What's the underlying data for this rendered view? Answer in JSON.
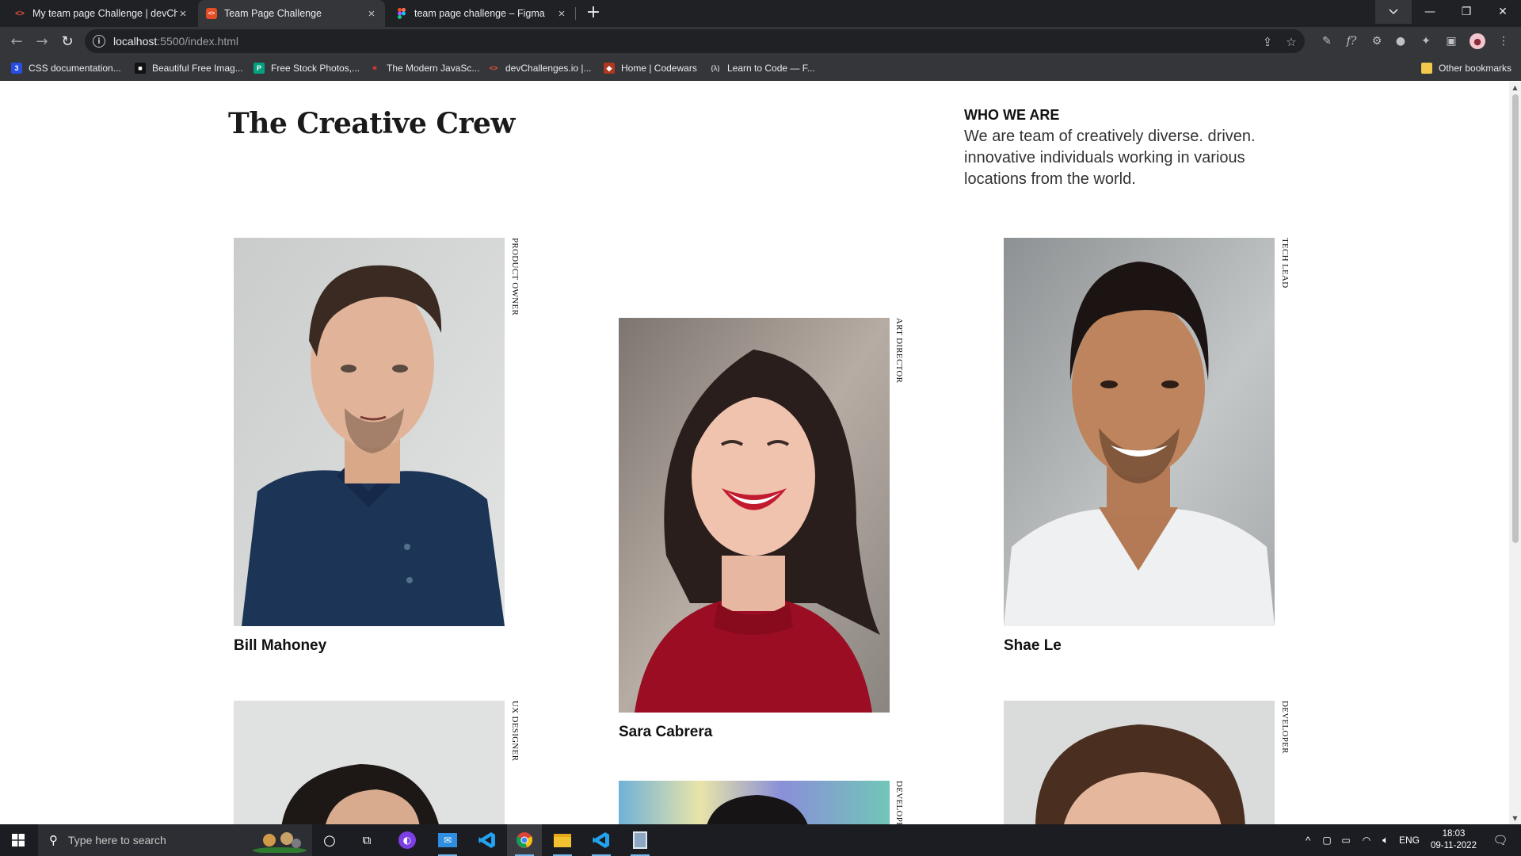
{
  "browser": {
    "tabs": [
      {
        "title": "My team page Challenge | devCh",
        "favicon": "devchallenges-icon",
        "active": false
      },
      {
        "title": "Team Page Challenge",
        "favicon": "html-file-icon",
        "active": true
      },
      {
        "title": "team page challenge – Figma",
        "favicon": "figma-icon",
        "active": false
      }
    ],
    "new_tab": "+",
    "url_host": "localhost",
    "url_path": ":5500/index.html",
    "bookmarks": [
      {
        "label": "CSS documentation...",
        "icon": "css-icon"
      },
      {
        "label": "Beautiful Free Imag...",
        "icon": "unsplash-icon"
      },
      {
        "label": "Free Stock Photos,...",
        "icon": "pexels-icon"
      },
      {
        "label": "The Modern JavaSc...",
        "icon": "javascript-info-icon"
      },
      {
        "label": "devChallenges.io |...",
        "icon": "devchallenges-icon"
      },
      {
        "label": "Home | Codewars",
        "icon": "codewars-icon"
      },
      {
        "label": "Learn to Code — F...",
        "icon": "freecodecamp-icon"
      }
    ],
    "other_bookmarks": "Other bookmarks"
  },
  "page": {
    "heading": "The Creative Crew",
    "who_title": "WHO WE ARE",
    "who_text": "We are team of creatively diverse. driven. innovative individuals working in various locations from the world.",
    "team": [
      {
        "name": "Bill Mahoney",
        "role": "PRODUCT OWNER"
      },
      {
        "name": "Sara Cabrera",
        "role": "ART DIRECTOR"
      },
      {
        "name": "Shae Le",
        "role": "TECH LEAD"
      },
      {
        "name": "",
        "role": "UX DESIGNER"
      },
      {
        "name": "",
        "role": "DEVELOPER"
      },
      {
        "name": "",
        "role": "DEVELOPER"
      }
    ]
  },
  "taskbar": {
    "search_placeholder": "Type here to search",
    "language": "ENG",
    "time": "18:03",
    "date": "09-11-2022"
  },
  "colors": {
    "chrome_dark": "#202124",
    "chrome_toolbar": "#35363a",
    "taskbar": "#1c1d22",
    "accent": "#76b9ed"
  }
}
